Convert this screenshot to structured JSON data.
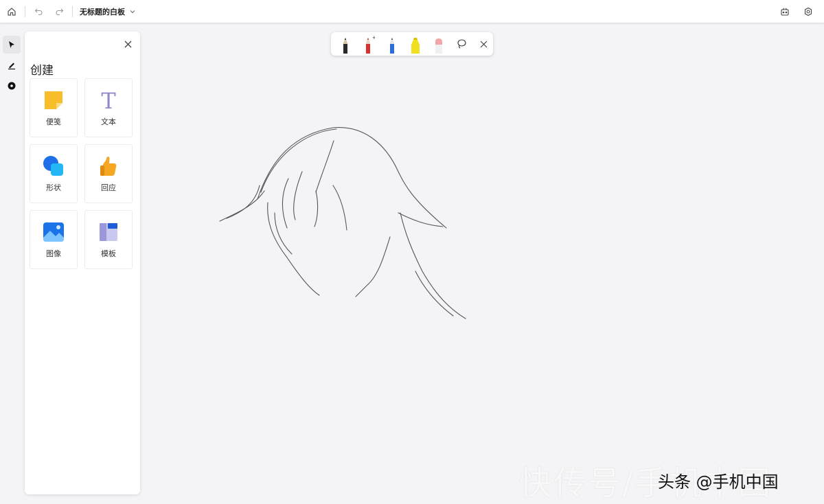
{
  "topbar": {
    "home_icon": "home-icon",
    "undo_icon": "undo-icon",
    "redo_icon": "redo-icon",
    "title": "无标题的白板",
    "settings_icon": "settings-icon",
    "share_icon": "share-icon"
  },
  "rail": {
    "tools": [
      {
        "name": "select-tool",
        "icon": "cursor-icon"
      },
      {
        "name": "pen-tool",
        "icon": "pen-icon"
      },
      {
        "name": "ink-tool",
        "icon": "ink-icon"
      }
    ]
  },
  "panel": {
    "title": "创建",
    "items": [
      {
        "label": "便笺",
        "icon": "sticky-note-icon",
        "color": "#f7b32b"
      },
      {
        "label": "文本",
        "icon": "text-icon",
        "color": "#8f8ac9"
      },
      {
        "label": "形状",
        "icon": "shapes-icon",
        "color": "#1e7cf0"
      },
      {
        "label": "回应",
        "icon": "thumbs-up-icon",
        "color": "#f5a623"
      },
      {
        "label": "图像",
        "icon": "image-icon",
        "color": "#1c6fe0"
      },
      {
        "label": "模板",
        "icon": "template-icon",
        "color": "#4d5fd1"
      }
    ]
  },
  "pen_toolbar": {
    "pens": [
      {
        "name": "pen-black",
        "color": "#1a1a1a"
      },
      {
        "name": "pen-red",
        "color": "#d93030"
      },
      {
        "name": "pen-blue",
        "color": "#2b6ed6"
      },
      {
        "name": "highlighter-yellow",
        "color": "#f0e020"
      },
      {
        "name": "eraser",
        "color": "#f0a5a5"
      }
    ],
    "lasso_icon": "lasso-icon",
    "close_icon": "close-icon"
  },
  "watermark": {
    "large": "快传号/手机中国",
    "small": "头条 @手机中国"
  }
}
